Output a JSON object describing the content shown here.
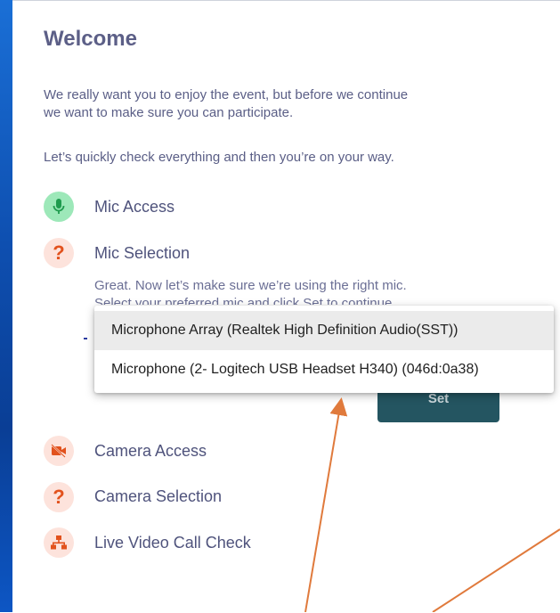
{
  "welcome": {
    "title": "Welcome",
    "intro_line1": "We really want you to enjoy the event, but before we continue",
    "intro_line2": "we want to make sure you can participate.",
    "check_line": "Let’s quickly check everything and then you’re on your way."
  },
  "steps": {
    "mic_access": {
      "label": "Mic Access",
      "icon": "microphone-icon",
      "status": "ok"
    },
    "mic_selection": {
      "label": "Mic Selection",
      "icon": "question-icon",
      "status": "pending",
      "desc_line1": "Great. Now let’s make sure we’re using the right mic.",
      "desc_line2": "Select your preferred mic and click Set to continue."
    },
    "camera_access": {
      "label": "Camera Access",
      "icon": "camera-off-icon",
      "status": "blocked"
    },
    "camera_selection": {
      "label": "Camera Selection",
      "icon": "question-icon",
      "status": "pending"
    },
    "video_call_check": {
      "label": "Live Video Call Check",
      "icon": "network-icon",
      "status": "pending"
    }
  },
  "mic_dropdown": {
    "options": [
      "Microphone Array (Realtek High Definition Audio(SST))",
      "Microphone (2- Logitech USB Headset H340) (046d:0a38)"
    ],
    "highlighted_index": 0
  },
  "set_button": {
    "label": "Set"
  },
  "colors": {
    "title": "#5c5f87",
    "accent_orange": "#e2521d",
    "ok_green": "#9de8b9",
    "button_teal": "#245561",
    "annotation_arrow": "#e07a3c"
  }
}
